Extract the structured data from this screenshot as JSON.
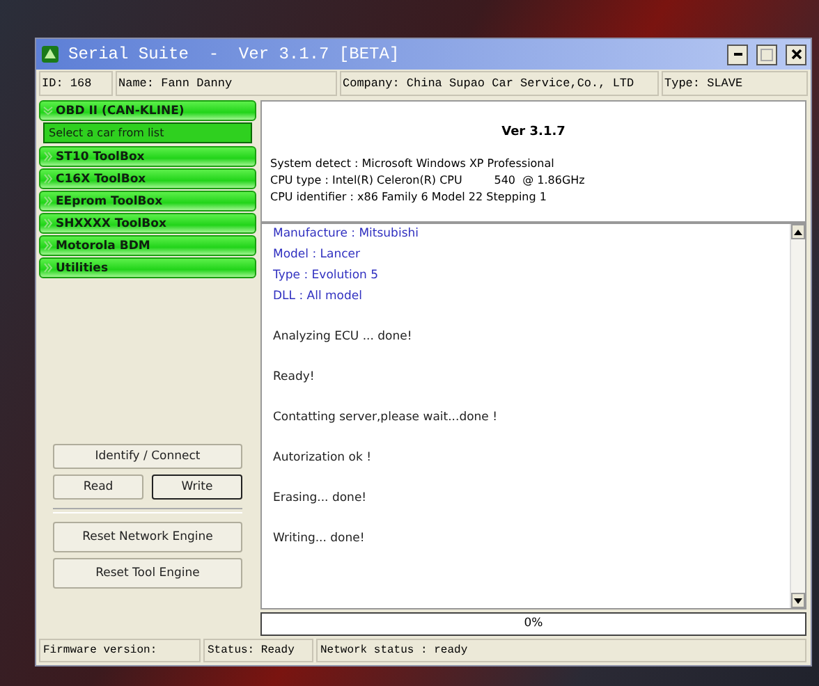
{
  "window": {
    "title": "Serial Suite  -  Ver 3.1.7 [BETA]"
  },
  "info_bar": [
    "ID: 168",
    "Name: Fann Danny",
    "Company: China Supao Car Service,Co., LTD",
    "Type: SLAVE"
  ],
  "sidebar": {
    "groups": [
      {
        "label": "OBD II (CAN-KLINE)",
        "expanded": true,
        "children": [
          {
            "label": "Select a car from list"
          }
        ]
      },
      {
        "label": "ST10 ToolBox",
        "expanded": false
      },
      {
        "label": "C16X ToolBox",
        "expanded": false
      },
      {
        "label": "EEprom ToolBox",
        "expanded": false
      },
      {
        "label": "SHXXXX ToolBox",
        "expanded": false
      },
      {
        "label": "Motorola BDM",
        "expanded": false
      },
      {
        "label": "Utilities",
        "expanded": false
      }
    ]
  },
  "button_rows": [
    [
      {
        "label": "Identify / Connect",
        "focused": false
      }
    ],
    [
      {
        "label": "Read",
        "focused": false
      },
      {
        "label": "Write",
        "focused": true
      }
    ],
    [
      {
        "label": "Reset Network Engine",
        "focused": false
      }
    ],
    [
      {
        "label": "Reset Tool Engine",
        "focused": false
      }
    ]
  ],
  "system_info": {
    "heading": "Ver 3.1.7",
    "lines": [
      "System detect : Microsoft Windows XP Professional",
      "CPU type : Intel(R) Celeron(R) CPU         540  @ 1.86GHz",
      "CPU identifier : x86 Family 6 Model 22 Stepping 1"
    ]
  },
  "log": [
    {
      "text": "Manufacture : Mitsubishi",
      "kind": "info"
    },
    {
      "text": "Model : Lancer",
      "kind": "info"
    },
    {
      "text": "Type : Evolution 5",
      "kind": "info"
    },
    {
      "text": "DLL : All model",
      "kind": "info"
    },
    {
      "text": "Analyzing ECU ...  done!",
      "kind": "message"
    },
    {
      "text": "Ready!",
      "kind": "message"
    },
    {
      "text": "Contatting server,please wait...done !",
      "kind": "message"
    },
    {
      "text": "Autorization ok !",
      "kind": "message"
    },
    {
      "text": "Erasing...  done!",
      "kind": "message"
    },
    {
      "text": "Writing...  done!",
      "kind": "message"
    }
  ],
  "progress": {
    "level": 0,
    "reading": "0%"
  },
  "status_bar": [
    "Firmware version:",
    "Status: Ready",
    "Network status : ready"
  ]
}
